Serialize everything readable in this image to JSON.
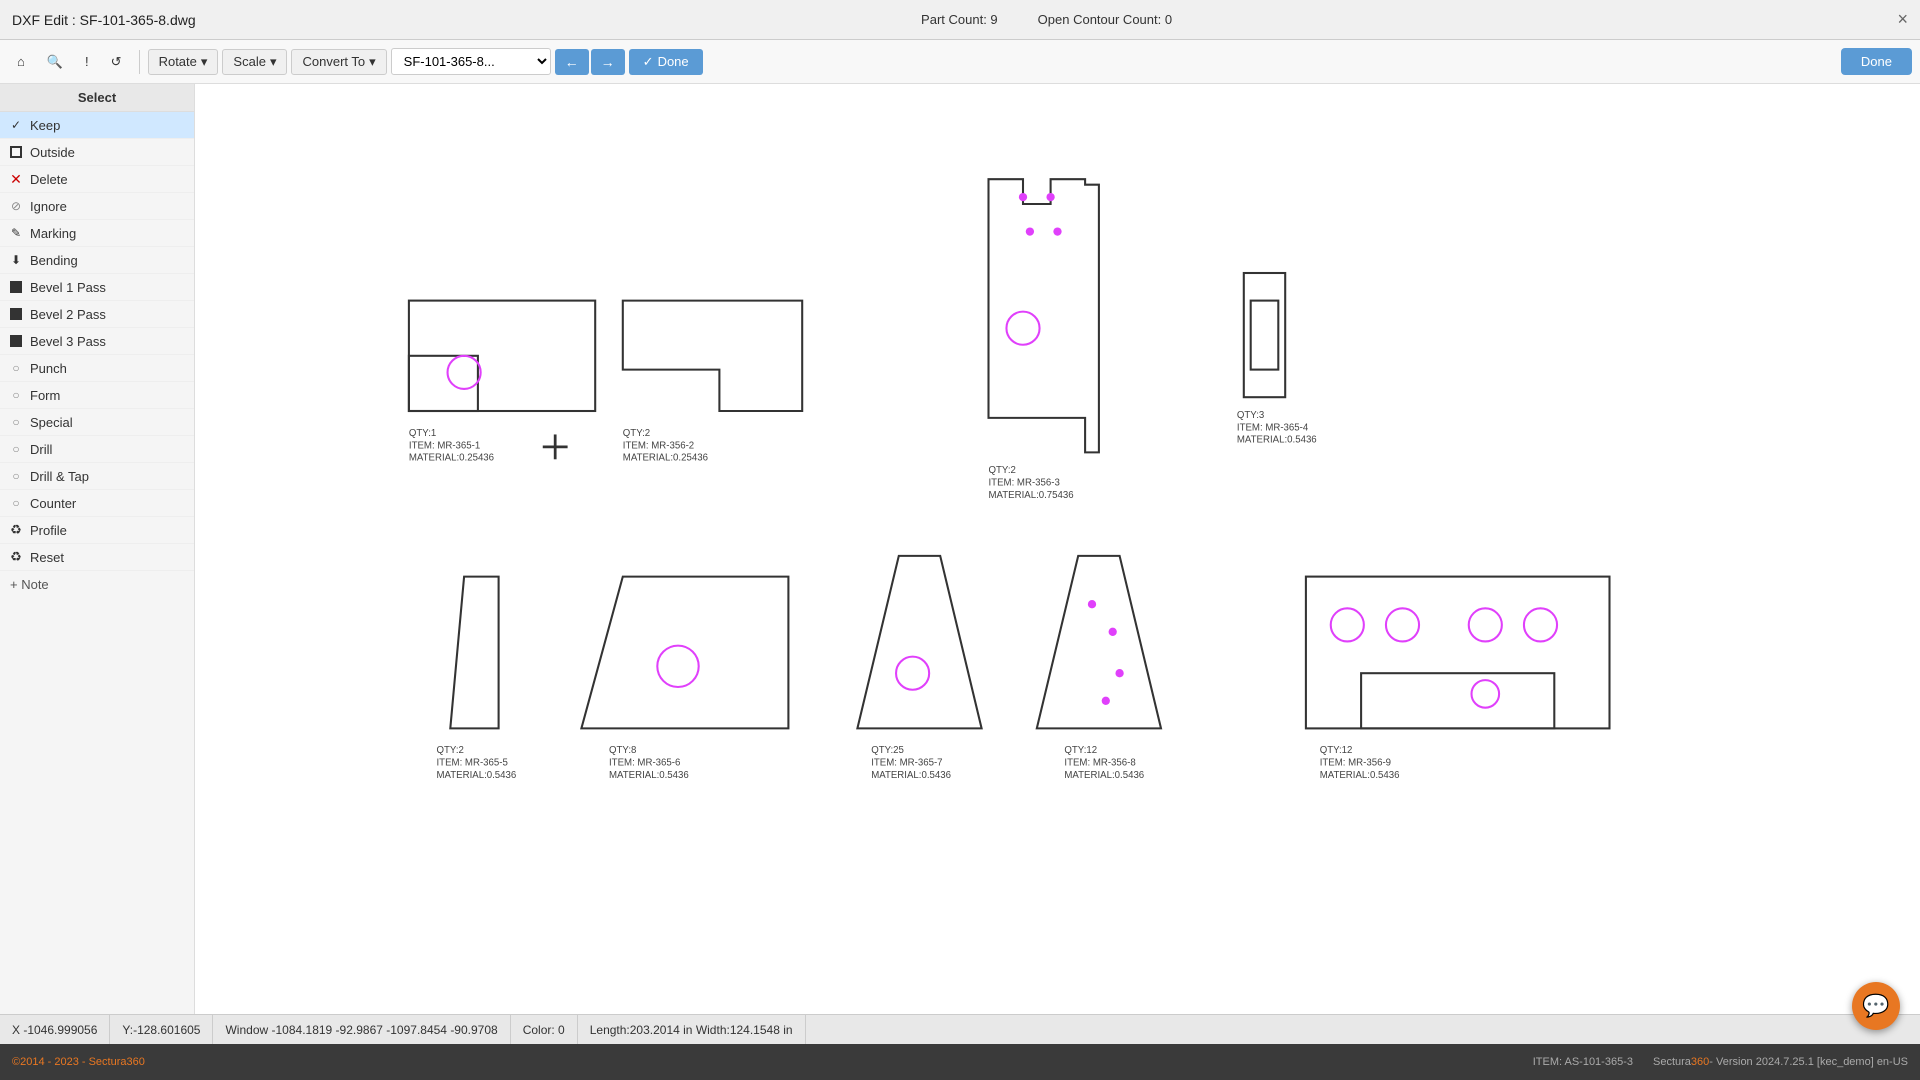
{
  "titleBar": {
    "title": "DXF Edit : SF-101-365-8.dwg",
    "partCount": "Part Count: 9",
    "openContourCount": "Open Contour Count: 0",
    "closeBtn": "×"
  },
  "toolbar": {
    "homeIcon": "⌂",
    "searchIcon": "🔍",
    "exclamIcon": "!",
    "refreshIcon": "↺",
    "rotateLabel": "Rotate",
    "scaleLabel": "Scale",
    "convertToLabel": "Convert To",
    "fileSelectValue": "SF-101-365-8...",
    "prevArrow": "←",
    "nextArrow": "→",
    "doneCheckmark": "✓",
    "doneLabel": "Done"
  },
  "doneButtonRight": "Done",
  "sidebar": {
    "header": "Select",
    "items": [
      {
        "id": "keep",
        "label": "Keep",
        "icon": "check",
        "active": true
      },
      {
        "id": "outside",
        "label": "Outside",
        "icon": "square"
      },
      {
        "id": "delete",
        "label": "Delete",
        "icon": "xmark"
      },
      {
        "id": "ignore",
        "label": "Ignore",
        "icon": "circle-x"
      },
      {
        "id": "marking",
        "label": "Marking",
        "icon": "edit"
      },
      {
        "id": "bending",
        "label": "Bending",
        "icon": "download"
      },
      {
        "id": "bevel1pass",
        "label": "Bevel 1 Pass",
        "icon": "square-fill"
      },
      {
        "id": "bevel2pass",
        "label": "Bevel 2 Pass",
        "icon": "square-fill"
      },
      {
        "id": "bevel3pass",
        "label": "Bevel 3 Pass",
        "icon": "square-fill"
      },
      {
        "id": "punch",
        "label": "Punch",
        "icon": "circle-outline"
      },
      {
        "id": "form",
        "label": "Form",
        "icon": "circle-outline"
      },
      {
        "id": "special",
        "label": "Special",
        "icon": "circle-outline"
      },
      {
        "id": "drill",
        "label": "Drill",
        "icon": "circle-outline"
      },
      {
        "id": "drilltap",
        "label": "Drill & Tap",
        "icon": "circle-outline"
      },
      {
        "id": "counter",
        "label": "Counter",
        "icon": "circle-outline"
      },
      {
        "id": "profile",
        "label": "Profile",
        "icon": "recycle"
      },
      {
        "id": "reset",
        "label": "Reset",
        "icon": "recycle"
      }
    ],
    "addNote": "+ Note"
  },
  "statusBar": {
    "x": "X -1046.999056",
    "y": "Y:-128.601605",
    "window": "Window -1084.1819 -92.9867 -1097.8454 -90.9708",
    "color": "Color: 0",
    "length": "Length:203.2014 in Width:124.1548 in"
  },
  "bottomBar": {
    "copyright": "©2014 - 2023 - Sectura",
    "brand": "360",
    "itemInfo": "ITEM: AS-101-365-3",
    "versionInfo": "Sectura",
    "versionBrand": "360",
    "versionDetail": "- Version 2024.7.25.1 [kec_demo] en-US"
  },
  "parts": [
    {
      "id": "part1",
      "qty": "QTY:1",
      "item": "ITEM: MR-365-1",
      "material": "MATERIAL:0.25436"
    },
    {
      "id": "part2",
      "qty": "QTY:2",
      "item": "ITEM: MR-356-2",
      "material": "MATERIAL:0.25436"
    },
    {
      "id": "part3",
      "qty": "QTY:2",
      "item": "ITEM: MR-356-3",
      "material": "MATERIAL:0.75436"
    },
    {
      "id": "part4",
      "qty": "QTY:3",
      "item": "ITEM: MR-365-4",
      "material": "MATERIAL:0.5436"
    },
    {
      "id": "part5",
      "qty": "QTY:2",
      "item": "ITEM: MR-365-5",
      "material": "MATERIAL:0.5436"
    },
    {
      "id": "part6",
      "qty": "QTY:8",
      "item": "ITEM: MR-365-6",
      "material": "MATERIAL:0.5436"
    },
    {
      "id": "part7",
      "qty": "QTY:25",
      "item": "ITEM: MR-365-7",
      "material": "MATERIAL:0.5436"
    },
    {
      "id": "part8",
      "qty": "QTY:12",
      "item": "ITEM: MR-356-8",
      "material": "MATERIAL:0.5436"
    },
    {
      "id": "part9",
      "qty": "QTY:12",
      "item": "ITEM: MR-356-9",
      "material": "MATERIAL:0.5436"
    }
  ]
}
